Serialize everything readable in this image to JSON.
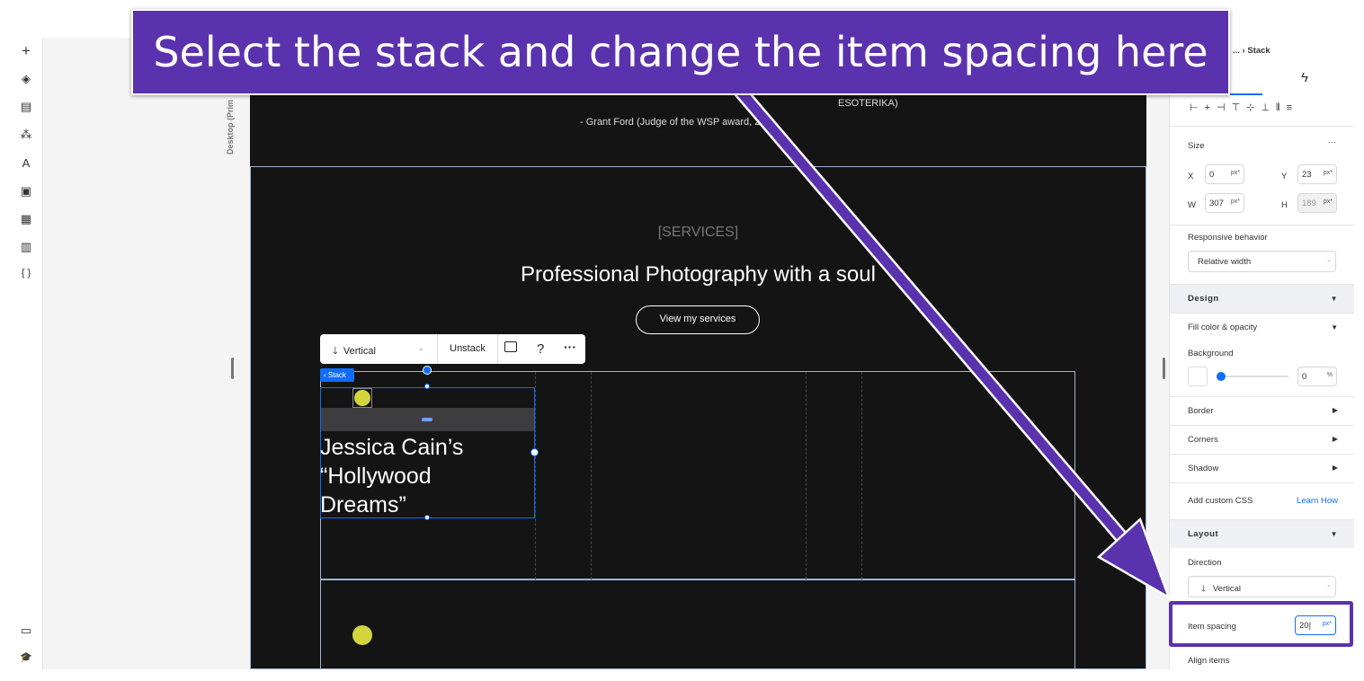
{
  "callout": {
    "text": "Select the stack and change the item spacing here",
    "color": "#5b32ad"
  },
  "left_toolbar": {
    "icons": [
      "plus-icon",
      "layers-icon",
      "page-icon",
      "components-icon",
      "typography-icon",
      "image-icon",
      "apps-icon",
      "table-icon",
      "code-icon",
      "chat-icon",
      "learn-icon"
    ],
    "glyphs": [
      "+",
      "◈",
      "▤",
      "⁂",
      "A",
      "▣",
      "▦",
      "▥",
      "{ }",
      "▭",
      "🎓"
    ]
  },
  "canvas": {
    "device_label": "Desktop (Prim",
    "quote_attr": "- Grant Ford (Judge of the WSP award, 20",
    "quote_tail": "ESOTERIKA)",
    "services_tag": "[SERVICES]",
    "services_title": "Professional Photography with a soul",
    "services_button": "View my services",
    "stack_tag": "Stack",
    "item_title": "Jessica Cain’s “Hollywood Dreams”",
    "accent": "#116dff",
    "floating_toolbar": {
      "direction": "Vertical",
      "unstack": "Unstack",
      "comment": "comment-icon",
      "help": "?",
      "more": "···"
    }
  },
  "panel": {
    "breadcrumb": "... › Stack",
    "size": {
      "label": "Size",
      "x_label": "X",
      "x": "0",
      "y_label": "Y",
      "y": "23",
      "w_label": "W",
      "w": "307",
      "h_label": "H",
      "h": "189",
      "unit": "px*"
    },
    "responsive": {
      "label": "Responsive behavior",
      "value": "Relative width"
    },
    "design": "Design",
    "fill": "Fill color & opacity",
    "background": {
      "label": "Background",
      "opacity": "0",
      "unit": "%"
    },
    "border": "Border",
    "corners": "Corners",
    "shadow": "Shadow",
    "custom_css": "Add custom CSS",
    "learn_how": "Learn How",
    "layout": "Layout",
    "direction": {
      "label": "Direction",
      "value": "Vertical"
    },
    "item_spacing": {
      "label": "Item spacing",
      "value": "20",
      "unit": "px*"
    },
    "align_items": "Align items"
  }
}
